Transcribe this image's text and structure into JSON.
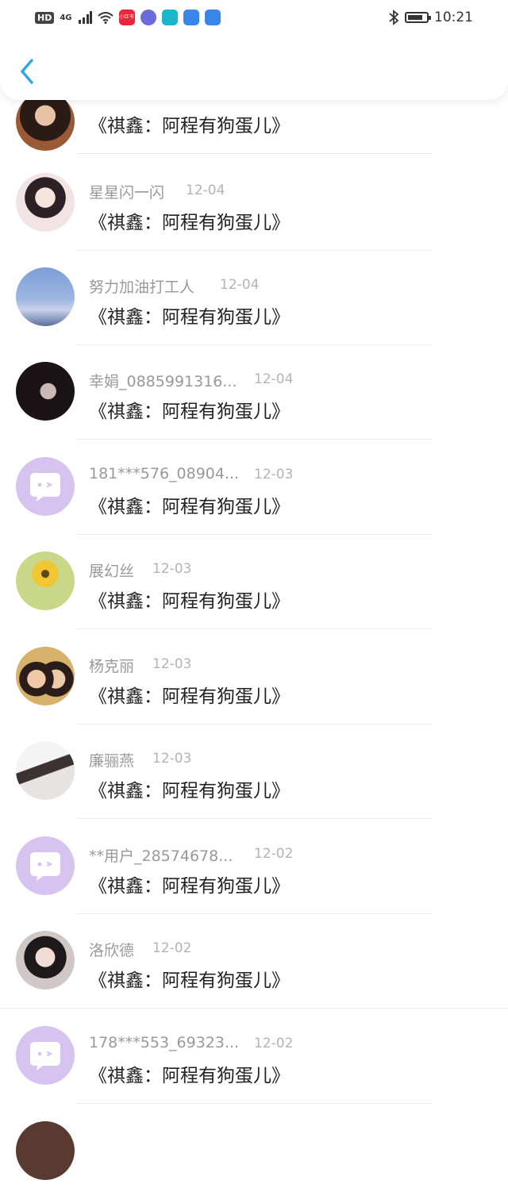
{
  "status_bar": {
    "hd": "HD",
    "network": "4G",
    "app_label": "小红书",
    "time": "10:21",
    "colors": {
      "red": "#e8273b",
      "purple": "#6b6bd9",
      "teal": "#1cb6c8",
      "blue": "#3a86e8"
    }
  },
  "header": {
    "back_icon": "chevron-left-icon",
    "accent": "#2ea7e0"
  },
  "avatar_placeholder_color": "#d6c3f0",
  "items": [
    {
      "name": "",
      "date": "",
      "msg": "《祺鑫：阿程有狗蛋儿》"
    },
    {
      "name": "星星闪一闪",
      "date": "12-04",
      "msg": "《祺鑫：阿程有狗蛋儿》"
    },
    {
      "name": "努力加油打工人",
      "date": "12-04",
      "msg": "《祺鑫：阿程有狗蛋儿》"
    },
    {
      "name": "幸娟_0885991316...",
      "date": "12-04",
      "msg": "《祺鑫：阿程有狗蛋儿》"
    },
    {
      "name": "181***576_08904...",
      "date": "12-03",
      "msg": "《祺鑫：阿程有狗蛋儿》"
    },
    {
      "name": "展幻丝",
      "date": "12-03",
      "msg": "《祺鑫：阿程有狗蛋儿》"
    },
    {
      "name": "杨克丽",
      "date": "12-03",
      "msg": "《祺鑫：阿程有狗蛋儿》"
    },
    {
      "name": "廉骊燕",
      "date": "12-03",
      "msg": "《祺鑫：阿程有狗蛋儿》"
    },
    {
      "name": "**用户_28574678...",
      "date": "12-02",
      "msg": "《祺鑫：阿程有狗蛋儿》"
    },
    {
      "name": "洛欣德",
      "date": "12-02",
      "msg": "《祺鑫：阿程有狗蛋儿》"
    },
    {
      "name": "178***553_69323...",
      "date": "12-02",
      "msg": "《祺鑫：阿程有狗蛋儿》"
    }
  ]
}
